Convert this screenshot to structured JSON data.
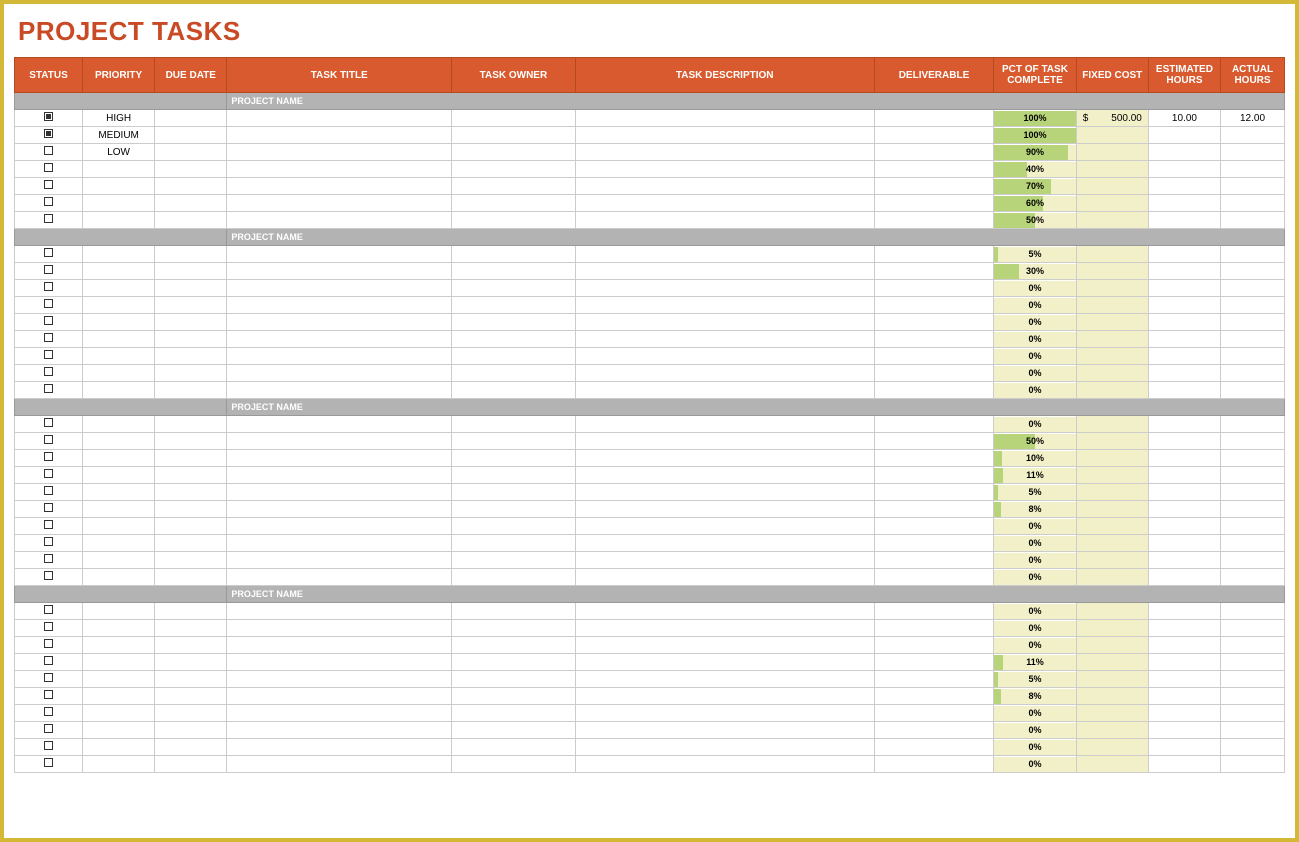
{
  "title": "PROJECT TASKS",
  "headers": {
    "status": "STATUS",
    "priority": "PRIORITY",
    "dueDate": "DUE DATE",
    "taskTitle": "TASK TITLE",
    "taskOwner": "TASK OWNER",
    "taskDesc": "TASK DESCRIPTION",
    "deliverable": "DELIVERABLE",
    "pctComplete": "PCT OF TASK COMPLETE",
    "fixedCost": "FIXED COST",
    "estHours": "ESTIMATED HOURS",
    "actHours": "ACTUAL HOURS"
  },
  "sectionLabel": "PROJECT NAME",
  "sections": [
    {
      "rows": [
        {
          "checked": true,
          "priority": "HIGH",
          "pct": 100,
          "fixedCost": "500.00",
          "estHours": "10.00",
          "actHours": "12.00"
        },
        {
          "checked": true,
          "priority": "MEDIUM",
          "pct": 100
        },
        {
          "checked": false,
          "priority": "LOW",
          "pct": 90
        },
        {
          "checked": false,
          "pct": 40
        },
        {
          "checked": false,
          "pct": 70
        },
        {
          "checked": false,
          "pct": 60
        },
        {
          "checked": false,
          "pct": 50
        }
      ]
    },
    {
      "rows": [
        {
          "checked": false,
          "pct": 5
        },
        {
          "checked": false,
          "pct": 30
        },
        {
          "checked": false,
          "pct": 0
        },
        {
          "checked": false,
          "pct": 0
        },
        {
          "checked": false,
          "pct": 0
        },
        {
          "checked": false,
          "pct": 0
        },
        {
          "checked": false,
          "pct": 0
        },
        {
          "checked": false,
          "pct": 0
        },
        {
          "checked": false,
          "pct": 0
        }
      ]
    },
    {
      "rows": [
        {
          "checked": false,
          "pct": 0
        },
        {
          "checked": false,
          "pct": 50
        },
        {
          "checked": false,
          "pct": 10
        },
        {
          "checked": false,
          "pct": 11
        },
        {
          "checked": false,
          "pct": 5
        },
        {
          "checked": false,
          "pct": 8
        },
        {
          "checked": false,
          "pct": 0
        },
        {
          "checked": false,
          "pct": 0
        },
        {
          "checked": false,
          "pct": 0
        },
        {
          "checked": false,
          "pct": 0
        }
      ]
    },
    {
      "rows": [
        {
          "checked": false,
          "pct": 0
        },
        {
          "checked": false,
          "pct": 0
        },
        {
          "checked": false,
          "pct": 0
        },
        {
          "checked": false,
          "pct": 11
        },
        {
          "checked": false,
          "pct": 5
        },
        {
          "checked": false,
          "pct": 8
        },
        {
          "checked": false,
          "pct": 0
        },
        {
          "checked": false,
          "pct": 0
        },
        {
          "checked": false,
          "pct": 0
        },
        {
          "checked": false,
          "pct": 0
        }
      ]
    }
  ]
}
